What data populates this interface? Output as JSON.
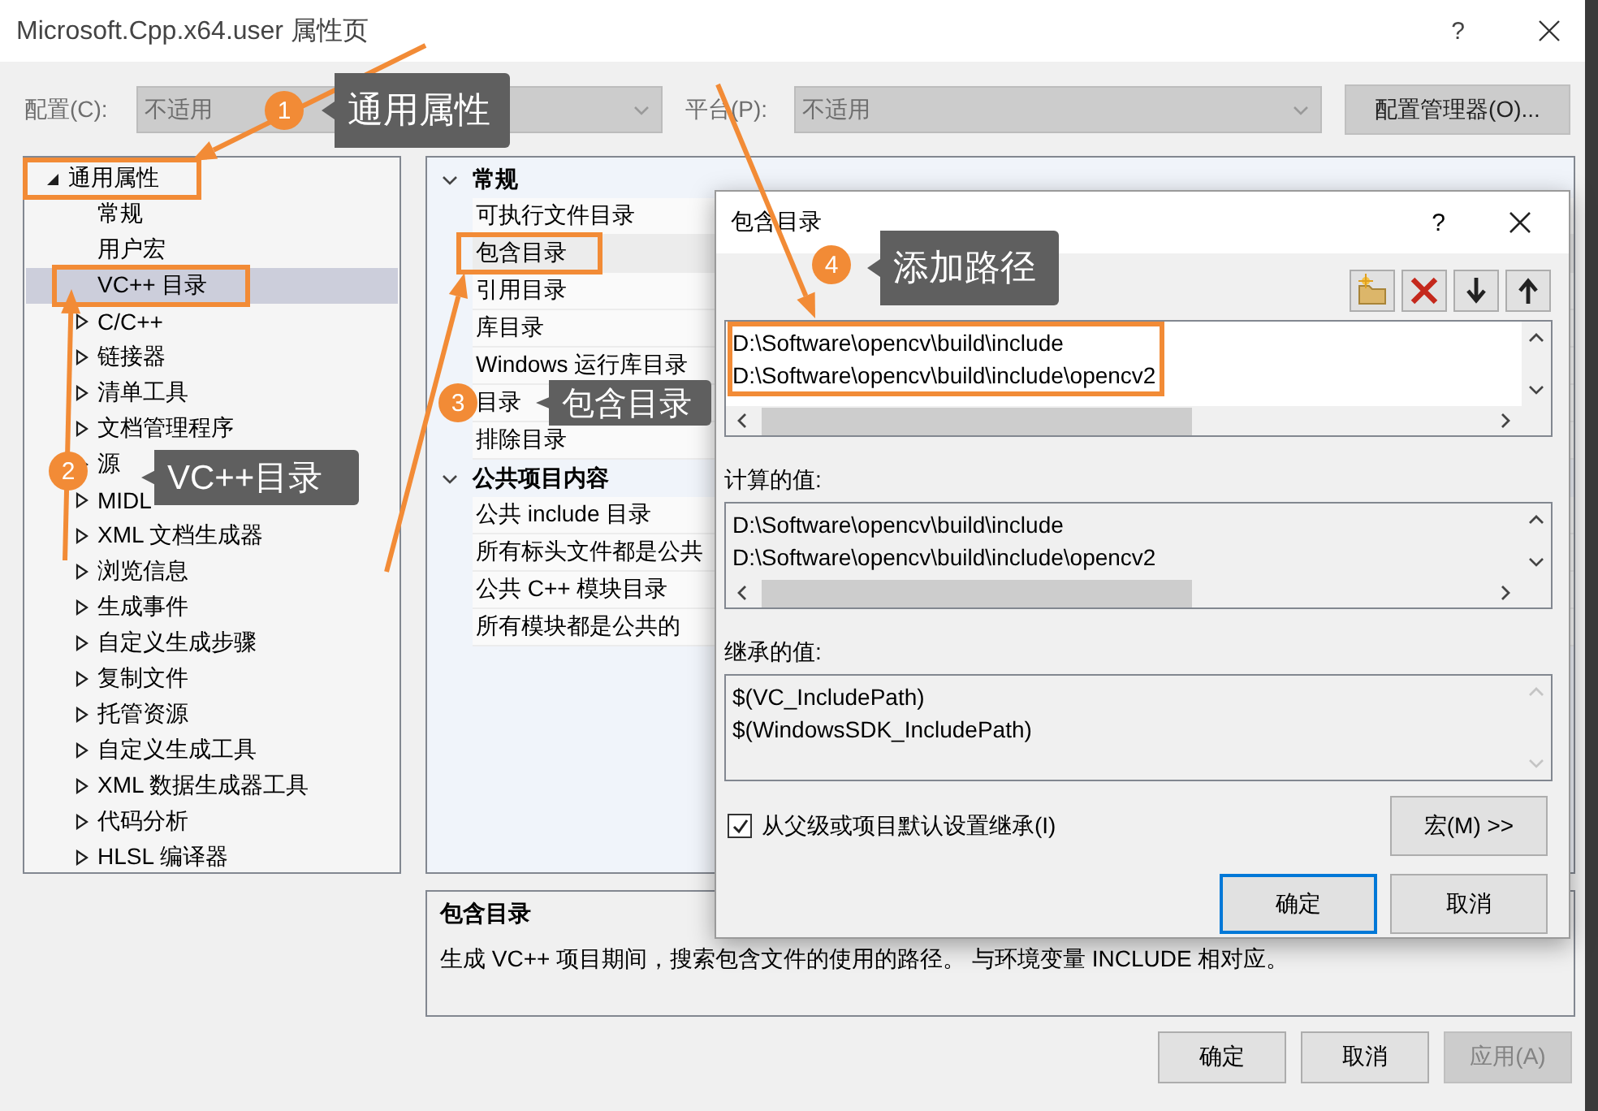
{
  "window": {
    "title": "Microsoft.Cpp.x64.user 属性页",
    "help": "?"
  },
  "config": {
    "label": "配置(C):",
    "value": "不适用",
    "disabled": true
  },
  "platform": {
    "label": "平台(P):",
    "value": "不适用",
    "disabled": true
  },
  "config_manager_button": "配置管理器(O)...",
  "tree": {
    "items": [
      {
        "label": "通用属性",
        "expanded": true,
        "selected": false,
        "highlighted": true,
        "children": [
          {
            "label": "常规",
            "selected": false,
            "highlighted": false
          },
          {
            "label": "用户宏",
            "selected": false,
            "highlighted": false
          },
          {
            "label": "VC++ 目录",
            "selected": true,
            "highlighted": true
          },
          {
            "label": "C/C++",
            "expanded": false,
            "selected": false,
            "highlighted": false
          },
          {
            "label": "链接器",
            "expanded": false,
            "selected": false,
            "highlighted": false
          },
          {
            "label": "清单工具",
            "expanded": false,
            "selected": false,
            "highlighted": false
          },
          {
            "label": "文档管理程序",
            "expanded": false,
            "selected": false,
            "highlighted": false
          },
          {
            "label": "源",
            "expanded": false,
            "selected": false,
            "highlighted": false
          },
          {
            "label": "MIDL",
            "expanded": false,
            "selected": false,
            "highlighted": false
          },
          {
            "label": "XML 文档生成器",
            "expanded": false,
            "selected": false,
            "highlighted": false
          },
          {
            "label": "浏览信息",
            "expanded": false,
            "selected": false,
            "highlighted": false
          },
          {
            "label": "生成事件",
            "expanded": false,
            "selected": false,
            "highlighted": false
          },
          {
            "label": "自定义生成步骤",
            "expanded": false,
            "selected": false,
            "highlighted": false
          },
          {
            "label": "复制文件",
            "expanded": false,
            "selected": false,
            "highlighted": false
          },
          {
            "label": "托管资源",
            "expanded": false,
            "selected": false,
            "highlighted": false
          },
          {
            "label": "自定义生成工具",
            "expanded": false,
            "selected": false,
            "highlighted": false
          },
          {
            "label": "XML 数据生成器工具",
            "expanded": false,
            "selected": false,
            "highlighted": false
          },
          {
            "label": "代码分析",
            "expanded": false,
            "selected": false,
            "highlighted": false
          },
          {
            "label": "HLSL 编译器",
            "expanded": false,
            "selected": false,
            "highlighted": false
          }
        ]
      }
    ]
  },
  "grid": {
    "sections": [
      {
        "title": "常规",
        "expanded": true,
        "rows": [
          {
            "label": "可执行文件目录",
            "selected": false,
            "highlighted": false
          },
          {
            "label": "包含目录",
            "selected": true,
            "highlighted": true
          },
          {
            "label": "引用目录",
            "selected": false,
            "highlighted": false
          },
          {
            "label": "库目录",
            "selected": false,
            "highlighted": false
          },
          {
            "label": "Windows 运行库目录",
            "selected": false,
            "highlighted": false
          },
          {
            "label": "目录",
            "selected": false,
            "highlighted": false
          },
          {
            "label": "排除目录",
            "selected": false,
            "highlighted": false
          }
        ]
      },
      {
        "title": "公共项目内容",
        "expanded": true,
        "rows": [
          {
            "label": "公共 include 目录",
            "selected": false,
            "highlighted": false
          },
          {
            "label": "所有标头文件都是公共",
            "selected": false,
            "highlighted": false
          },
          {
            "label": "公共 C++ 模块目录",
            "selected": false,
            "highlighted": false
          },
          {
            "label": "所有模块都是公共的",
            "selected": false,
            "highlighted": false
          }
        ]
      }
    ]
  },
  "description": {
    "title": "包含目录",
    "text": "生成 VC++ 项目期间，搜索包含文件的使用的路径。 与环境变量 INCLUDE 相对应。"
  },
  "buttons": [
    {
      "label": "确定",
      "disabled": false
    },
    {
      "label": "取消",
      "disabled": false
    },
    {
      "label": "应用(A)",
      "disabled": true
    }
  ],
  "dialog": {
    "title": "包含目录",
    "help": "?",
    "toolbar": [
      {
        "kind": "new-folder"
      },
      {
        "kind": "delete"
      },
      {
        "kind": "move-down"
      },
      {
        "kind": "move-up"
      }
    ],
    "entries": [
      "D:\\Software\\opencv\\build\\include",
      "D:\\Software\\opencv\\build\\include\\opencv2"
    ],
    "entries_highlighted": true,
    "computed_label": "计算的值:",
    "computed": [
      "D:\\Software\\opencv\\build\\include",
      "D:\\Software\\opencv\\build\\include\\opencv2"
    ],
    "inherited_label": "继承的值:",
    "inherited": [
      "$(VC_IncludePath)",
      "$(WindowsSDK_IncludePath)"
    ],
    "inherit_checkbox": {
      "label": "从父级或项目默认设置继承(I)",
      "checked": true
    },
    "macros_button": "宏(M) >>",
    "buttons": [
      {
        "label": "确定",
        "default": true
      },
      {
        "label": "取消",
        "default": false
      }
    ]
  },
  "annotations": [
    {
      "number": "1",
      "text": "通用属性"
    },
    {
      "number": "2",
      "text": "VC++目录"
    },
    {
      "number": "3",
      "text": "包含目录"
    },
    {
      "number": "4",
      "text": "添加路径"
    }
  ]
}
